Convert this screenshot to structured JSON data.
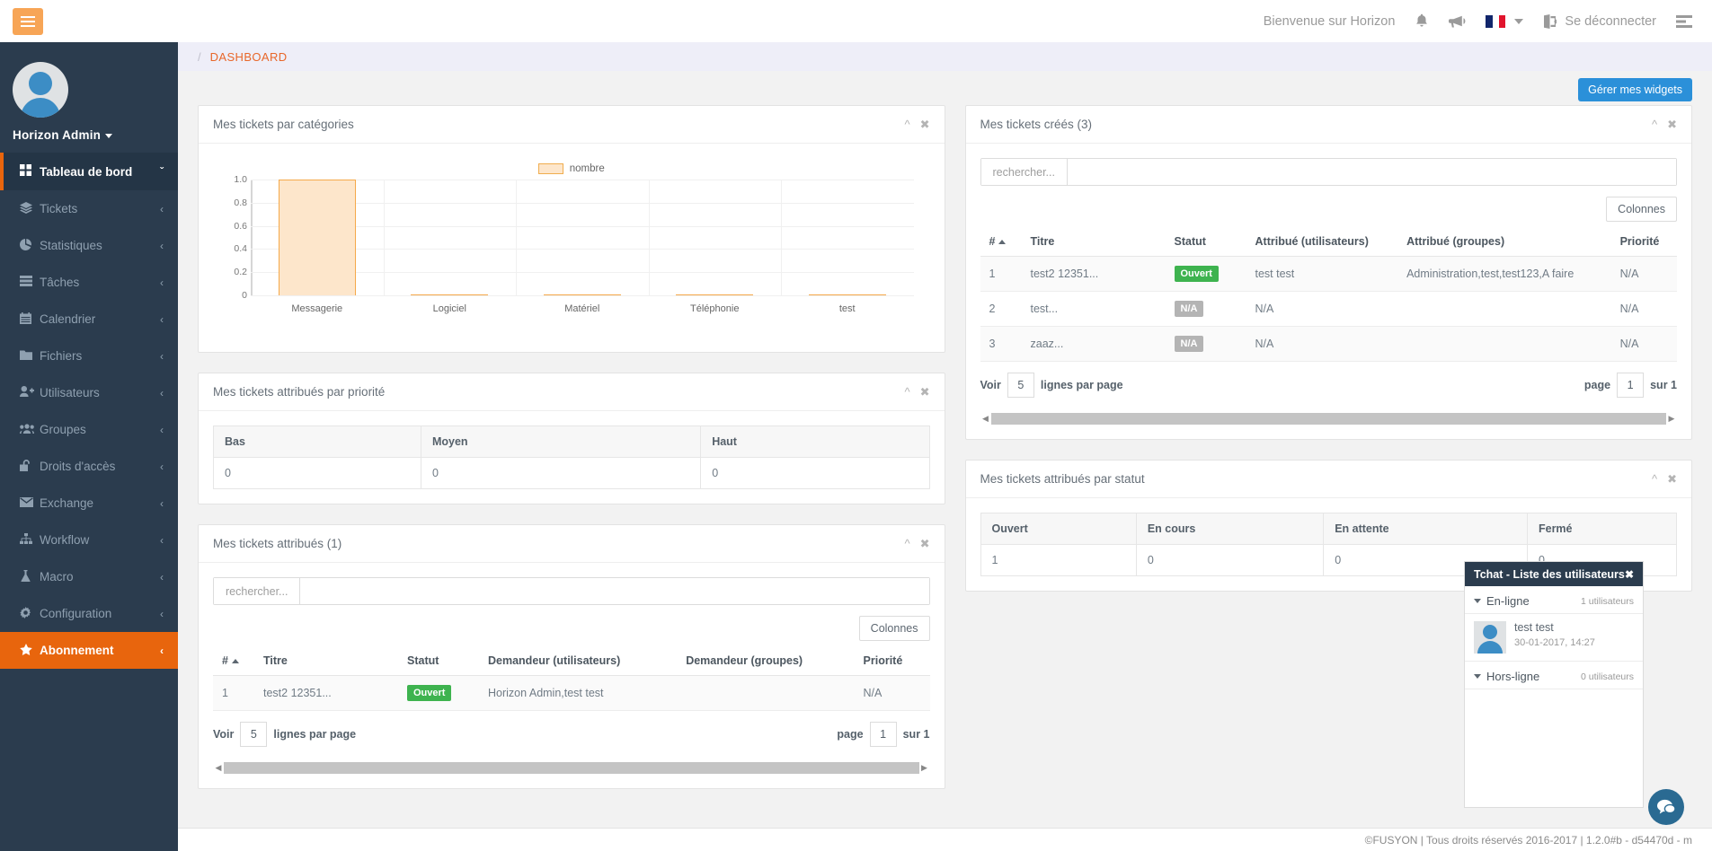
{
  "topbar": {
    "menu_toggle": "hamburger-icon",
    "welcome": "Bienvenue sur Horizon",
    "notifications_icon": "bell-icon",
    "announcements_icon": "megaphone-icon",
    "language": "FR",
    "logout_label": "Se déconnecter",
    "panel_toggle_icon": "list-toggle-icon"
  },
  "sidebar": {
    "user_name": "Horizon Admin",
    "items": [
      {
        "label": "Tableau de bord",
        "icon": "grid-icon",
        "state": "active",
        "arrow": "ˇ"
      },
      {
        "label": "Tickets",
        "icon": "tickets-icon",
        "state": "normal",
        "arrow": "‹"
      },
      {
        "label": "Statistiques",
        "icon": "pie-chart-icon",
        "state": "normal",
        "arrow": "‹"
      },
      {
        "label": "Tâches",
        "icon": "tasks-icon",
        "state": "normal",
        "arrow": "‹"
      },
      {
        "label": "Calendrier",
        "icon": "calendar-icon",
        "state": "normal",
        "arrow": "‹"
      },
      {
        "label": "Fichiers",
        "icon": "folder-icon",
        "state": "normal",
        "arrow": "‹"
      },
      {
        "label": "Utilisateurs",
        "icon": "user-plus-icon",
        "state": "normal",
        "arrow": "‹"
      },
      {
        "label": "Groupes",
        "icon": "users-icon",
        "state": "normal",
        "arrow": "‹"
      },
      {
        "label": "Droits d'accès",
        "icon": "unlock-icon",
        "state": "normal",
        "arrow": "‹"
      },
      {
        "label": "Exchange",
        "icon": "envelope-icon",
        "state": "normal",
        "arrow": "‹"
      },
      {
        "label": "Workflow",
        "icon": "sitemap-icon",
        "state": "normal",
        "arrow": "‹"
      },
      {
        "label": "Macro",
        "icon": "flask-icon",
        "state": "normal",
        "arrow": "‹"
      },
      {
        "label": "Configuration",
        "icon": "gear-icon",
        "state": "normal",
        "arrow": "‹"
      },
      {
        "label": "Abonnement",
        "icon": "star-icon",
        "state": "highlight",
        "arrow": "‹"
      }
    ]
  },
  "breadcrumb": {
    "separator": "/",
    "current": "DASHBOARD"
  },
  "actions": {
    "manage_widgets": "Gérer mes widgets"
  },
  "widget_tools": {
    "collapse": "chevron-up-icon",
    "close": "close-icon"
  },
  "chart_data": {
    "type": "bar",
    "title": "Mes tickets par catégories",
    "categories": [
      "Messagerie",
      "Logiciel",
      "Matériel",
      "Téléphonie",
      "test"
    ],
    "values": [
      1,
      0,
      0,
      0,
      0
    ],
    "series": [
      {
        "name": "nombre",
        "values": [
          1,
          0,
          0,
          0,
          0
        ]
      }
    ],
    "legend": [
      "nombre"
    ],
    "legend_position": "top-center",
    "xlabel": "",
    "ylabel": "",
    "ylim": [
      0,
      1
    ],
    "yticks": [
      "1.0",
      "0.8",
      "0.6",
      "0.4",
      "0.2",
      "0"
    ],
    "grid": true,
    "bar_fill": "#fde6cb",
    "bar_border": "#f5a94a"
  },
  "priority_widget": {
    "title": "Mes tickets attribués par priorité",
    "headers": [
      "Bas",
      "Moyen",
      "Haut"
    ],
    "values": [
      "0",
      "0",
      "0"
    ]
  },
  "status_widget": {
    "title": "Mes tickets attribués par statut",
    "headers": [
      "Ouvert",
      "En cours",
      "En attente",
      "Fermé"
    ],
    "values": [
      "1",
      "0",
      "0",
      "0"
    ]
  },
  "created_tickets": {
    "title": "Mes tickets créés (3)",
    "search_label": "rechercher...",
    "search_value": "",
    "columns_button": "Colonnes",
    "headers": [
      "#",
      "Titre",
      "Statut",
      "Attribué (utilisateurs)",
      "Attribué (groupes)",
      "Priorité"
    ],
    "rows": [
      {
        "num": "1",
        "titre": "test2 12351...",
        "statut": "Ouvert",
        "statut_type": "ouvert",
        "users": "test test",
        "groups": "Administration,test,test123,A faire",
        "priorite": "N/A"
      },
      {
        "num": "2",
        "titre": "test...",
        "statut": "N/A",
        "statut_type": "na",
        "users": "N/A",
        "groups": "",
        "priorite": "N/A"
      },
      {
        "num": "3",
        "titre": "zaaz...",
        "statut": "N/A",
        "statut_type": "na",
        "users": "N/A",
        "groups": "",
        "priorite": "N/A"
      }
    ],
    "pager": {
      "voir": "Voir",
      "rows_per_page": "5",
      "rows_suffix": "lignes par page",
      "page_label": "page",
      "page_number": "1",
      "page_total": "sur 1"
    }
  },
  "assigned_tickets": {
    "title": "Mes tickets attribués (1)",
    "search_label": "rechercher...",
    "search_value": "",
    "columns_button": "Colonnes",
    "headers": [
      "#",
      "Titre",
      "Statut",
      "Demandeur (utilisateurs)",
      "Demandeur (groupes)",
      "Priorité"
    ],
    "rows": [
      {
        "num": "1",
        "titre": "test2 12351...",
        "statut": "Ouvert",
        "statut_type": "ouvert",
        "users": "Horizon Admin,test test",
        "groups": "",
        "priorite": "N/A"
      }
    ],
    "pager": {
      "voir": "Voir",
      "rows_per_page": "5",
      "rows_suffix": "lignes par page",
      "page_label": "page",
      "page_number": "1",
      "page_total": "sur 1"
    }
  },
  "chat": {
    "title": "Tchat - Liste des utilisateurs",
    "close_icon": "close-icon",
    "online_label": "En-ligne",
    "online_count": "1 utilisateurs",
    "offline_label": "Hors-ligne",
    "offline_count": "0 utilisateurs",
    "users": [
      {
        "name": "test test",
        "date": "30-01-2017, 14:27",
        "status": "online"
      }
    ],
    "bubble_icon": "chat-bubble-icon"
  },
  "footer": {
    "text": "©FUSYON | Tous droits réservés 2016-2017 | 1.2.0#b - d54470d - m"
  }
}
